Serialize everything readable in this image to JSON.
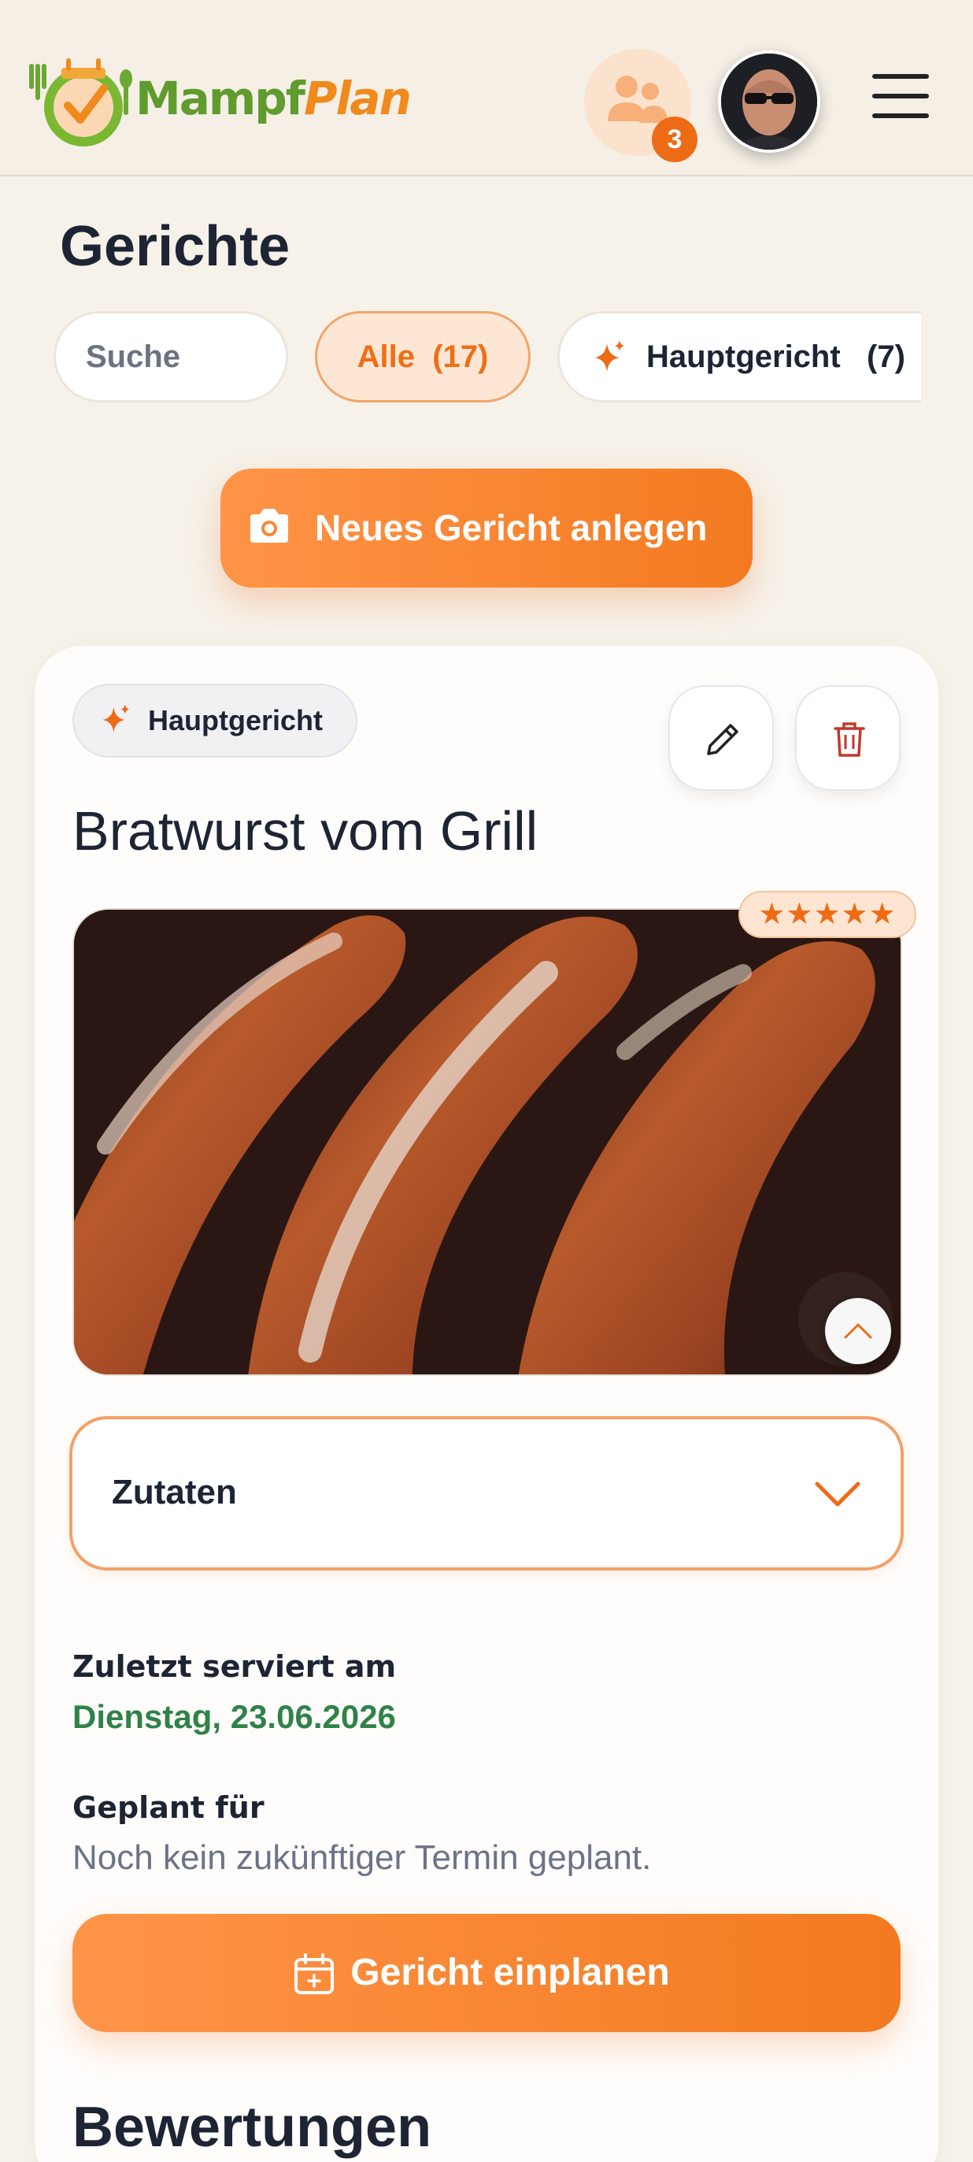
{
  "header": {
    "brand_part1": "Mampf",
    "brand_part2": "Plan",
    "household_count": "3",
    "colors": {
      "accent": "#f37a20",
      "brand_green": "#5f9b2e"
    }
  },
  "page": {
    "title": "Gerichte"
  },
  "filters": {
    "search_placeholder": "Suche",
    "all_label": "Alle",
    "all_count": "(17)",
    "main_label": "Hauptgericht",
    "main_count": "(7)"
  },
  "actions": {
    "new_dish": "Neues Gericht anlegen"
  },
  "dish": {
    "category": "Hauptgericht",
    "title": "Bratwurst vom Grill",
    "rating_stars": "★★★★★",
    "rating_value": 5,
    "ingredients_label": "Zutaten",
    "last_served_label": "Zuletzt serviert am",
    "last_served_date": "Dienstag, 23.06.2026",
    "planned_label": "Geplant für",
    "planned_text": "Noch kein zukünftiger Termin geplant.",
    "plan_button": "Gericht einplanen",
    "reviews_title": "Bewertungen"
  }
}
